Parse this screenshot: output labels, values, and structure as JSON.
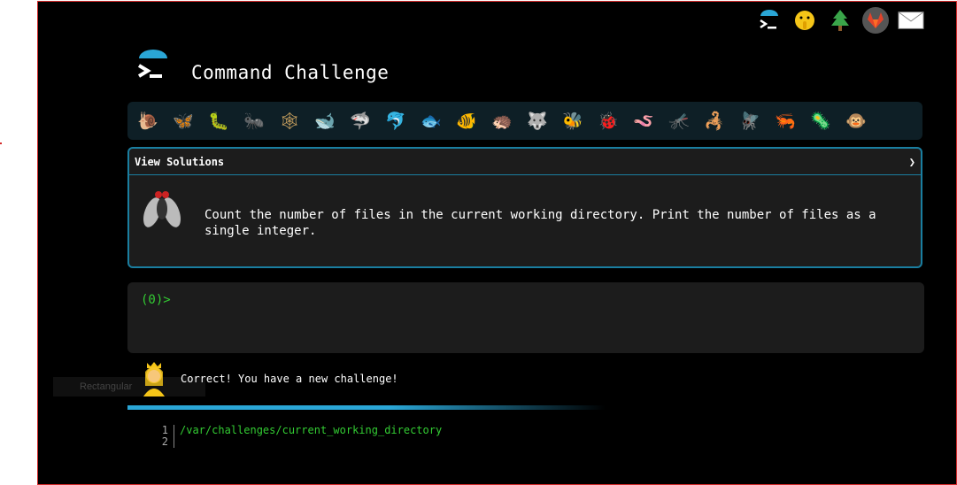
{
  "app": {
    "title": "Command Challenge"
  },
  "nav_icons": [
    {
      "name": "terminal-icon",
      "glyph": "›_"
    },
    {
      "name": "shush-face-icon",
      "glyph": "🤫"
    },
    {
      "name": "tree-icon",
      "glyph": "🌲"
    },
    {
      "name": "gitlab-icon",
      "glyph": "🦊"
    },
    {
      "name": "mail-icon",
      "glyph": "✉"
    }
  ],
  "animals": [
    {
      "name": "snail-icon",
      "glyph": "🐌"
    },
    {
      "name": "butterfly-icon",
      "glyph": "🦋"
    },
    {
      "name": "caterpillar-icon",
      "glyph": "🐛"
    },
    {
      "name": "ant-icon",
      "glyph": "🐜"
    },
    {
      "name": "spider-web-icon",
      "glyph": "🕸"
    },
    {
      "name": "whale-icon",
      "glyph": "🐋"
    },
    {
      "name": "shark-icon",
      "glyph": "🦈"
    },
    {
      "name": "dolphin-icon",
      "glyph": "🐬"
    },
    {
      "name": "fish-icon",
      "glyph": "🐟"
    },
    {
      "name": "tropical-fish-icon",
      "glyph": "🐠"
    },
    {
      "name": "hedgehog-icon",
      "glyph": "🦔"
    },
    {
      "name": "wolf-icon",
      "glyph": "🐺"
    },
    {
      "name": "bee-icon",
      "glyph": "🐝"
    },
    {
      "name": "ladybug-icon",
      "glyph": "🐞"
    },
    {
      "name": "worm-icon",
      "glyph": "🪱"
    },
    {
      "name": "mosquito-icon",
      "glyph": "🦟"
    },
    {
      "name": "scorpion-icon",
      "glyph": "🦂"
    },
    {
      "name": "fly-icon",
      "glyph": "🪰"
    },
    {
      "name": "shrimp-icon",
      "glyph": "🦐"
    },
    {
      "name": "microbe-icon",
      "glyph": "🦠"
    },
    {
      "name": "monkey-icon",
      "glyph": "🐵"
    }
  ],
  "panel": {
    "header": "View Solutions",
    "chevron": "❯",
    "task": "Count the number of files in the current working directory. Print the number of files as a single integer."
  },
  "terminal": {
    "prompt": "(0)>"
  },
  "feedback": {
    "ghost_label": "Rectangular",
    "message": "Correct! You have a new challenge!"
  },
  "code": {
    "lines": [
      {
        "num": "1",
        "text": "/var/challenges/current_working_directory"
      },
      {
        "num": "2",
        "text": ""
      }
    ]
  },
  "colors": {
    "accent": "#1a7ea0",
    "prompt_green": "#33cc33",
    "frame_border": "#d42a2a"
  }
}
